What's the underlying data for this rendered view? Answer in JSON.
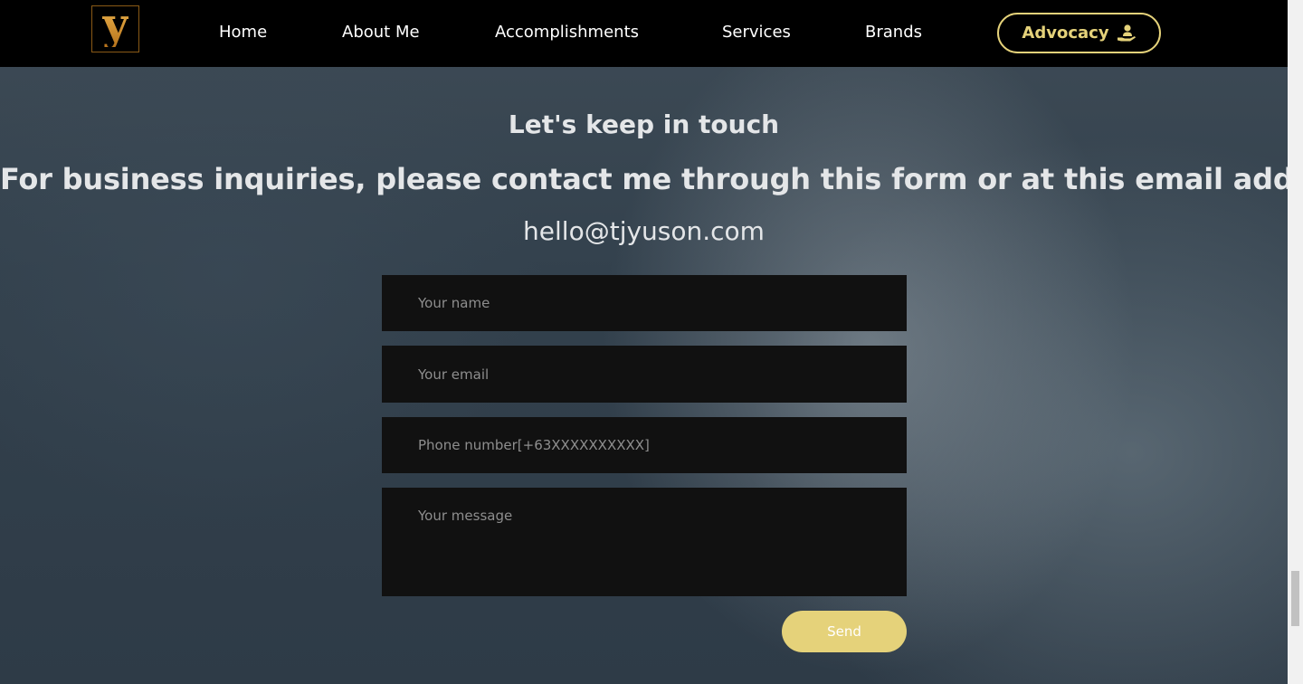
{
  "nav": {
    "logo_letter": "y",
    "items": [
      "Home",
      "About Me",
      "Accomplishments",
      "Services",
      "Brands"
    ],
    "advocacy_label": "Advocacy",
    "advocacy_icon": "hand-holding-person-icon",
    "accent_color": "#e5d27a"
  },
  "contact": {
    "heading": "Let's keep in touch",
    "subheading": "For business inquiries, please contact me through this form or at this email address",
    "email": "hello@tjyuson.com"
  },
  "form": {
    "name_placeholder": "Your name",
    "email_placeholder": "Your email",
    "phone_placeholder": "Phone number[+63XXXXXXXXXX]",
    "message_placeholder": "Your message",
    "send_label": "Send"
  }
}
